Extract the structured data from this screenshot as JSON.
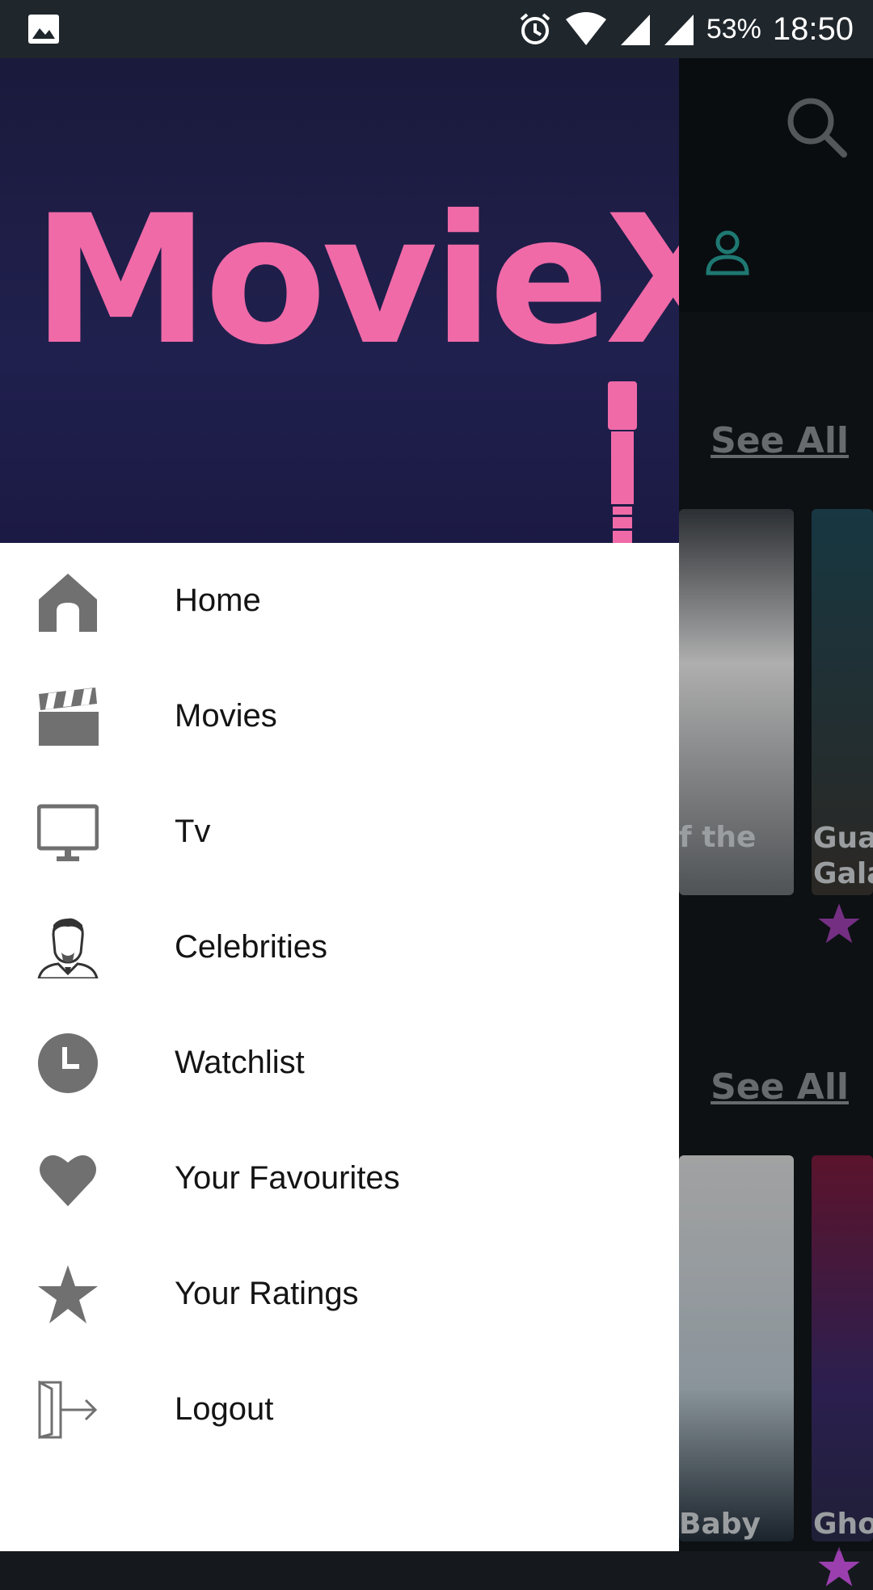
{
  "status_bar": {
    "battery": "53%",
    "time": "18:50"
  },
  "background": {
    "sections": [
      {
        "see_all": "See All",
        "posters": [
          {
            "title": "f the"
          },
          {
            "title": "Guar Galax"
          }
        ]
      },
      {
        "see_all": "See All",
        "posters": [
          {
            "title": "Baby"
          },
          {
            "title": "Ghos"
          }
        ]
      }
    ]
  },
  "drawer": {
    "logo": "MovieX",
    "menu": [
      {
        "label": "Home",
        "icon": "home-icon"
      },
      {
        "label": "Movies",
        "icon": "clapperboard-icon"
      },
      {
        "label": "Tv",
        "icon": "tv-icon"
      },
      {
        "label": "Celebrities",
        "icon": "celebrity-icon"
      },
      {
        "label": "Watchlist",
        "icon": "clock-icon"
      },
      {
        "label": "Your Favourites",
        "icon": "heart-icon"
      },
      {
        "label": "Your Ratings",
        "icon": "star-icon"
      },
      {
        "label": "Logout",
        "icon": "logout-icon"
      }
    ]
  },
  "colors": {
    "accent_pink": "#f06aa8",
    "header_bg": "#1f1e4a",
    "icon_gray": "#707070",
    "rating_purple": "#9b3fae",
    "profile_teal": "#2aa198"
  }
}
